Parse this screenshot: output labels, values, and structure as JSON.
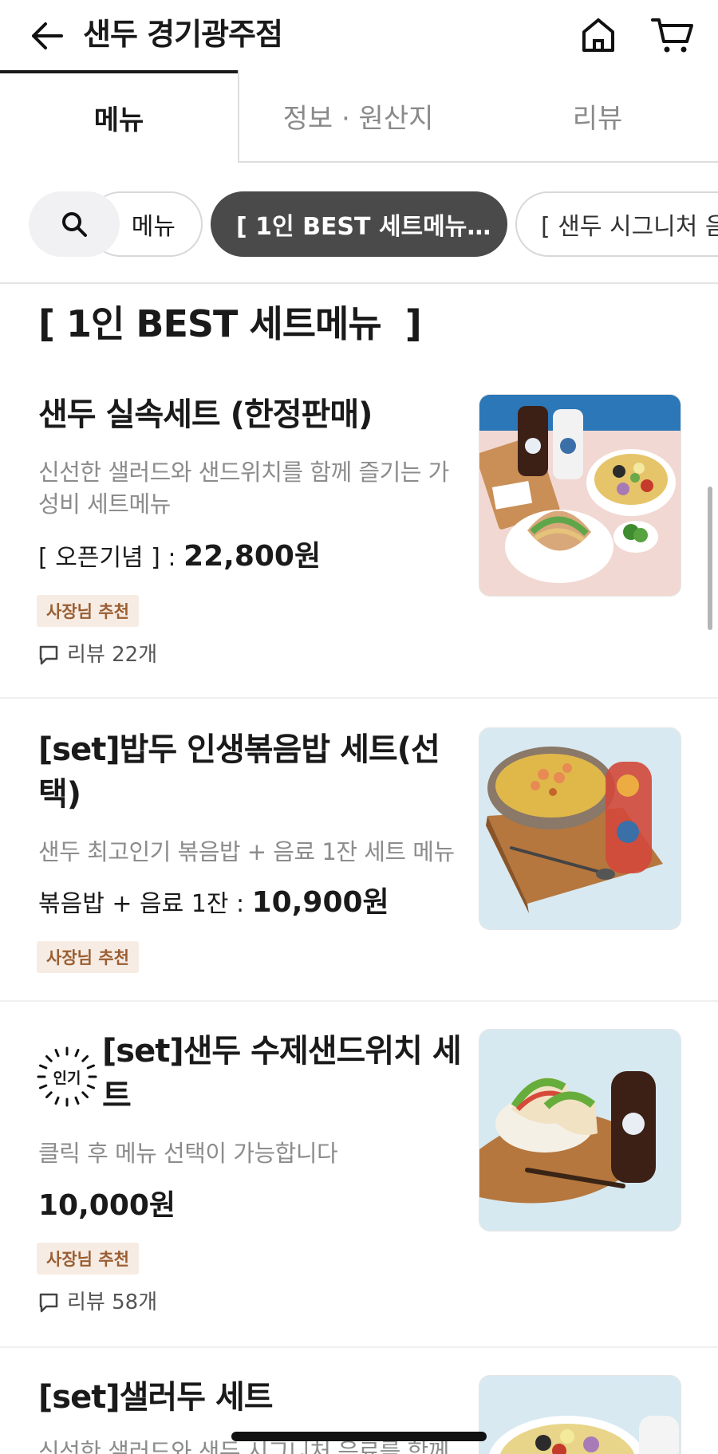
{
  "header": {
    "title": "샌두 경기광주점"
  },
  "tabs": [
    {
      "label": "메뉴",
      "active": true
    },
    {
      "label": "정보 · 원산지",
      "active": false
    },
    {
      "label": "리뷰",
      "active": false
    }
  ],
  "categories": {
    "prev": "메뉴",
    "active": "[ 1인 BEST 세트메뉴…",
    "next": "[ 샌두 시그니처 음"
  },
  "section": {
    "title": "[ 1인 BEST 세트메뉴  ]"
  },
  "items": [
    {
      "name": "샌두 실속세트 (한정판매)",
      "desc": "신선한 샐러드와 샌드위치를 함께 즐기는 가성비 세트메뉴",
      "price_prefix": "[ 오픈기념 ] : ",
      "price": "22,800원",
      "badge": "사장님 추천",
      "reviews": "리뷰 22개"
    },
    {
      "name": "[set]밥두 인생볶음밥 세트(선택)",
      "desc": "샌두 최고인기 볶음밥 + 음료 1잔 세트 메뉴",
      "price_prefix": "볶음밥 + 음료 1잔 : ",
      "price": "10,900원",
      "badge": "사장님 추천"
    },
    {
      "popular": "인기",
      "name": "[set]샌두 수제샌드위치 세트",
      "desc": "클릭 후 메뉴 선택이 가능합니다",
      "price": "10,000원",
      "badge": "사장님 추천",
      "reviews": "리뷰 58개"
    },
    {
      "name": "[set]샐러두 세트",
      "desc": "신선한 샐러드와 샌두 시그니처 음료를 함께"
    }
  ],
  "colors": {
    "active_chip": "#4a4a4a",
    "badge_bg": "#f6ece4",
    "badge_text": "#9a5e32"
  }
}
